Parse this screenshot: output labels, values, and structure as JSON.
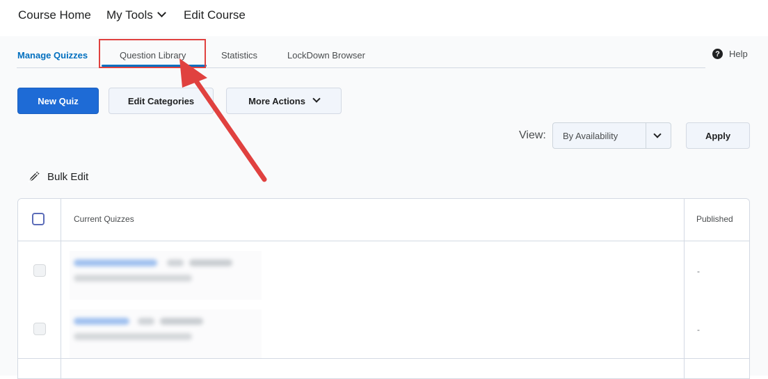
{
  "course_nav": {
    "home": "Course Home",
    "tools": "My Tools",
    "edit": "Edit Course"
  },
  "tabs": [
    {
      "label": "Manage Quizzes",
      "active": true
    },
    {
      "label": "Question Library",
      "active": false
    },
    {
      "label": "Statistics",
      "active": false
    },
    {
      "label": "LockDown Browser",
      "active": false
    }
  ],
  "help": {
    "label": "Help",
    "icon": "help-icon"
  },
  "toolbar": {
    "new_quiz": "New Quiz",
    "edit_categories": "Edit Categories",
    "more_actions": "More Actions"
  },
  "view": {
    "label": "View:",
    "selected": "By Availability",
    "apply": "Apply"
  },
  "bulk_edit": {
    "label": "Bulk Edit",
    "icon": "pencil-icon"
  },
  "table": {
    "columns": [
      "Current Quizzes",
      "Published"
    ],
    "rows": [
      {
        "quiz": "",
        "published": "-"
      },
      {
        "quiz": "",
        "published": "-"
      }
    ]
  },
  "colors": {
    "accent": "#006fbf",
    "primary_button": "#1e6bd6",
    "callout": "#e0413f"
  }
}
